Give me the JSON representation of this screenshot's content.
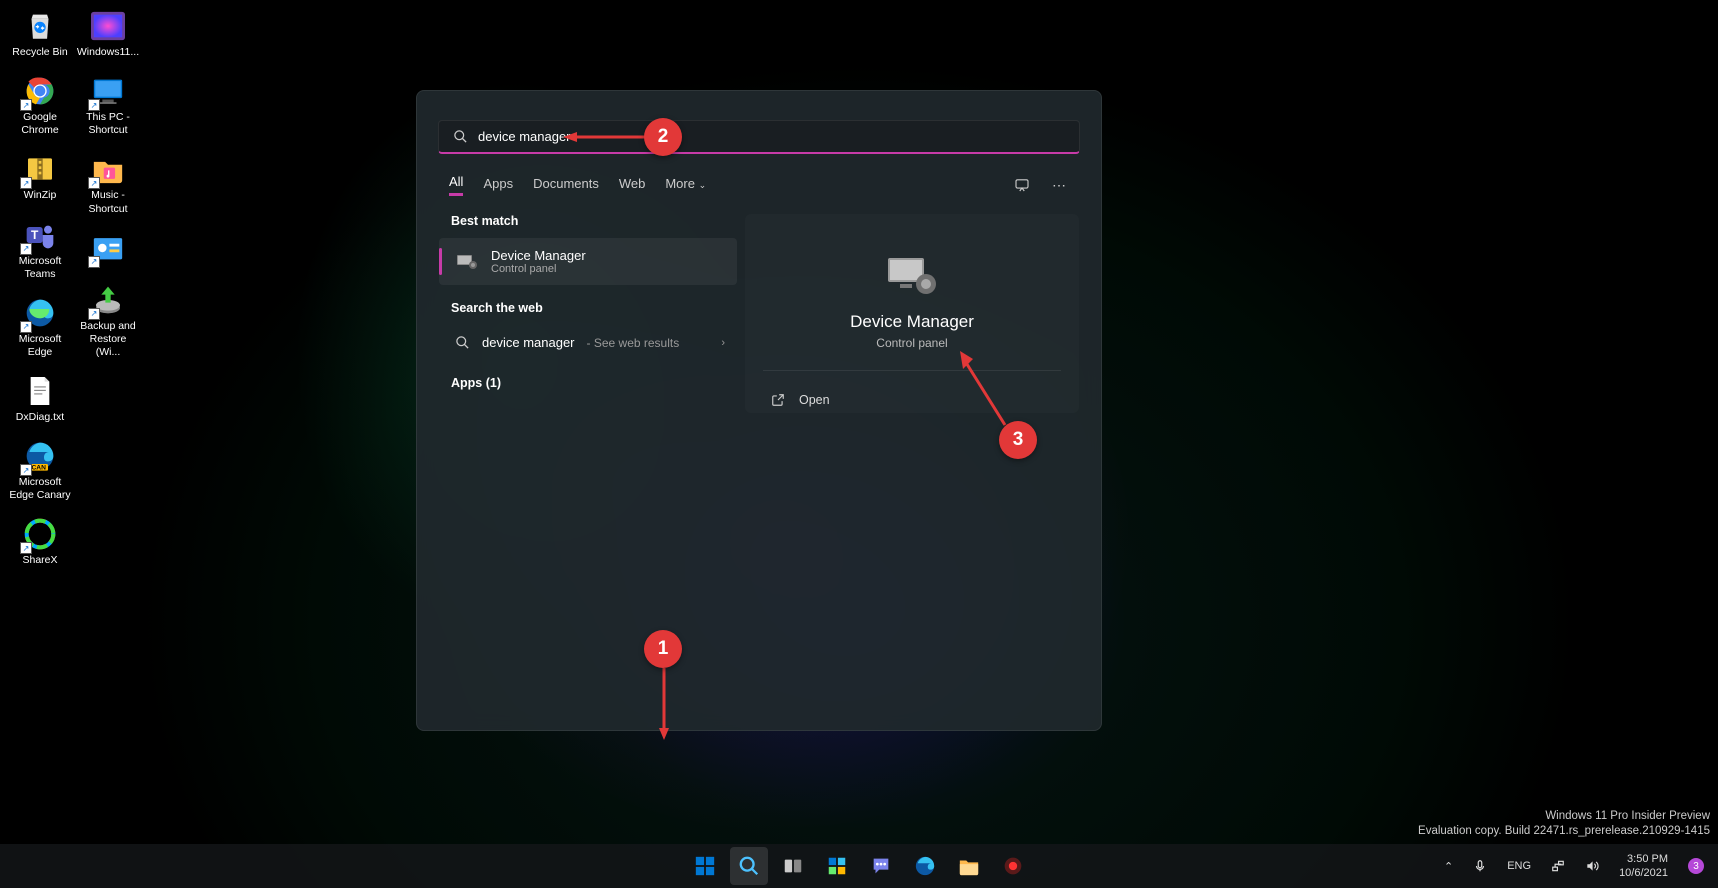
{
  "desktop_icons_col1": [
    {
      "name": "recycle-bin",
      "label": "Recycle Bin",
      "shortcut": false
    },
    {
      "name": "google-chrome",
      "label": "Google Chrome",
      "shortcut": true
    },
    {
      "name": "winzip",
      "label": "WinZip",
      "shortcut": true
    },
    {
      "name": "microsoft-teams",
      "label": "Microsoft Teams",
      "shortcut": true
    },
    {
      "name": "microsoft-edge",
      "label": "Microsoft Edge",
      "shortcut": true
    },
    {
      "name": "dxdiag",
      "label": "DxDiag.txt",
      "shortcut": false
    },
    {
      "name": "edge-canary",
      "label": "Microsoft Edge Canary",
      "shortcut": true
    },
    {
      "name": "sharex",
      "label": "ShareX",
      "shortcut": true
    }
  ],
  "desktop_icons_col2": [
    {
      "name": "windows11",
      "label": "Windows11...",
      "shortcut": false
    },
    {
      "name": "this-pc",
      "label": "This PC - Shortcut",
      "shortcut": true
    },
    {
      "name": "music",
      "label": "Music - Shortcut",
      "shortcut": true
    },
    {
      "name": "control-panel",
      "label": "",
      "shortcut": true
    },
    {
      "name": "backup-restore",
      "label": "Backup and Restore (Wi...",
      "shortcut": true
    }
  ],
  "search": {
    "value": "device manager"
  },
  "tabs": {
    "all": "All",
    "apps": "Apps",
    "documents": "Documents",
    "web": "Web",
    "more": "More"
  },
  "results": {
    "best_match_label": "Best match",
    "best_match": {
      "title": "Device Manager",
      "sub": "Control panel"
    },
    "web_label": "Search the web",
    "web_item": {
      "term": "device manager",
      "sub": "See web results"
    },
    "apps_label": "Apps (1)"
  },
  "preview": {
    "title": "Device Manager",
    "sub": "Control panel",
    "open": "Open"
  },
  "tray": {
    "lang": "ENG",
    "time": "3:50 PM",
    "date": "10/6/2021",
    "badge": "3"
  },
  "watermark": {
    "l1": "Windows 11 Pro Insider Preview",
    "l2": "Evaluation copy. Build 22471.rs_prerelease.210929-1415"
  },
  "annotations": {
    "a1": "1",
    "a2": "2",
    "a3": "3"
  }
}
